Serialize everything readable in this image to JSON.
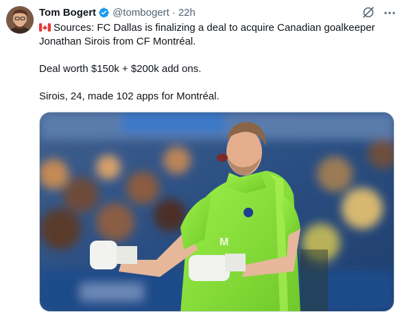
{
  "tweet": {
    "author_name": "Tom Bogert",
    "author_handle": "@tombogert",
    "separator": "·",
    "timestamp": "22h",
    "lines": [
      "Sources: FC Dallas is finalizing a deal to acquire Canadian goalkeeper",
      "Jonathan Sirois from CF Montréal.",
      "Deal worth $150k + $200k add ons.",
      "Sirois, 24, made 102 apps for Montréal."
    ],
    "flag_icon": "canada-flag-icon",
    "verified_icon": "verified-badge-icon",
    "media_description_icon": "photo-goalkeeper"
  },
  "colors": {
    "verified": "#1d9bf0",
    "secondary_text": "#536471",
    "jersey": "#8fe03c"
  }
}
